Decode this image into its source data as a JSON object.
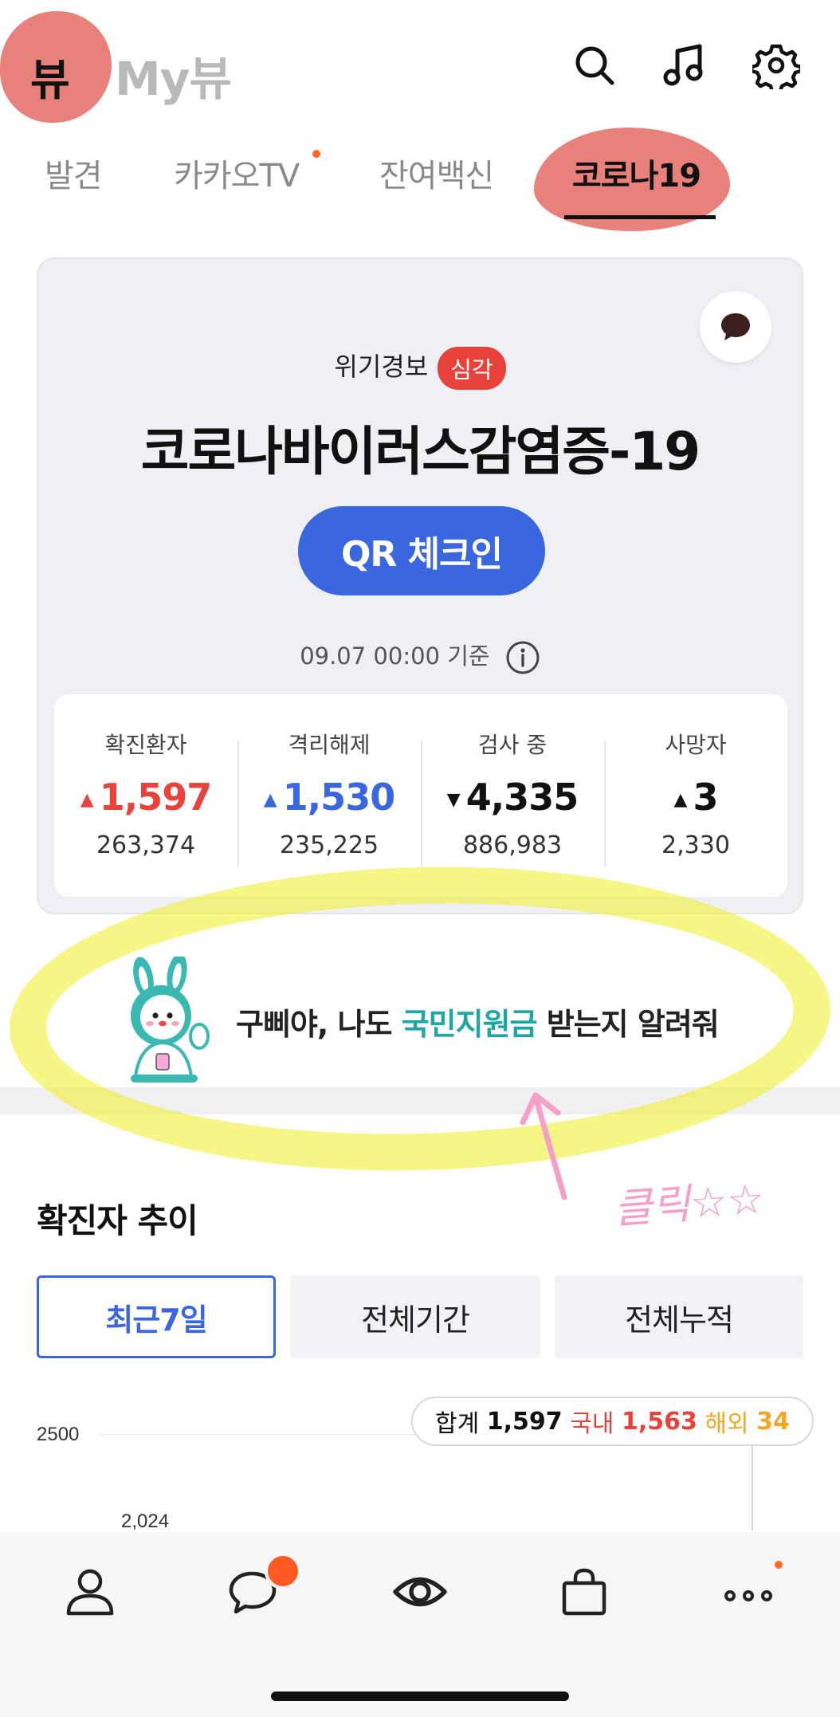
{
  "header": {
    "logo_badge": "뷰",
    "logo_text": "My뷰",
    "icons": [
      "search-icon",
      "music-icon",
      "gear-icon"
    ]
  },
  "tabs": [
    {
      "label": "발견",
      "active": false,
      "new_dot": false
    },
    {
      "label": "카카오TV",
      "active": false,
      "new_dot": true
    },
    {
      "label": "잔여백신",
      "active": false,
      "new_dot": false
    },
    {
      "label": "코로나19",
      "active": true,
      "new_dot": false
    }
  ],
  "card": {
    "alert_label": "위기경보",
    "alert_level": "심각",
    "title": "코로나바이러스감염증-19",
    "qr_button": "QR 체크인",
    "base_time": "09.07 00:00 기준",
    "stats": [
      {
        "label": "확진환자",
        "change": "1,597",
        "direction": "up",
        "color": "#e8423b",
        "total": "263,374"
      },
      {
        "label": "격리해제",
        "change": "1,530",
        "direction": "up",
        "color": "#3a66e0",
        "total": "235,225"
      },
      {
        "label": "검사 중",
        "change": "4,335",
        "direction": "down",
        "color": "#111111",
        "total": "886,983"
      },
      {
        "label": "사망자",
        "change": "3",
        "direction": "up",
        "color": "#111111",
        "total": "2,330"
      }
    ]
  },
  "banner": {
    "text_before": "구삐야, 나도 ",
    "text_highlight": "국민지원금",
    "text_after": " 받는지 알려줘"
  },
  "annotation": {
    "note": "클릭☆☆"
  },
  "trend": {
    "title": "확진자 추이",
    "periods": [
      {
        "label": "최근7일",
        "active": true
      },
      {
        "label": "전체기간",
        "active": false
      },
      {
        "label": "전체누적",
        "active": false
      }
    ],
    "y_tick": "2500",
    "partial_value": "2,024",
    "tooltip": {
      "total_label": "합계",
      "total_value": "1,597",
      "domestic_label": "국내",
      "domestic_value": "1,563",
      "overseas_label": "해외",
      "overseas_value": "34"
    }
  },
  "bottom_nav": [
    "profile-icon",
    "chat-icon",
    "view-icon",
    "shopping-icon",
    "more-icon"
  ],
  "colors": {
    "accent_blue": "#3a66e0",
    "alert_red": "#e8423b",
    "highlight_teal": "#1da6a3",
    "overseas_orange": "#f5a623",
    "notification_orange": "#ff6a2b"
  }
}
